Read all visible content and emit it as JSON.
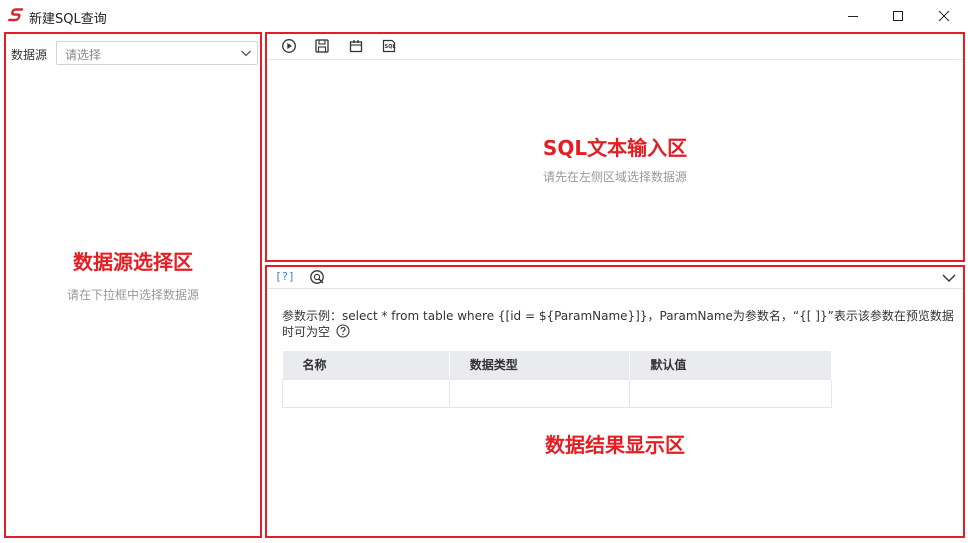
{
  "window": {
    "title": "新建SQL查询",
    "accent": "#e31e24"
  },
  "datasource": {
    "label": "数据源",
    "placeholder": "请选择",
    "area_title": "数据源选择区",
    "hint": "请在下拉框中选择数据源"
  },
  "sql": {
    "toolbar": [
      "run-icon",
      "save-icon",
      "calendar-icon",
      "sql-format-icon"
    ],
    "area_title": "SQL文本输入区",
    "hint": "请先在左侧区域选择数据源"
  },
  "result": {
    "param_help_label": "[?]",
    "param_example_text": "参数示例：select * from table where {[id = ${ParamName}]}，ParamName为参数名，“{[ ]}”表示该参数在预览数据时可为空",
    "columns": [
      "名称",
      "数据类型",
      "默认值"
    ],
    "area_title": "数据结果显示区"
  }
}
